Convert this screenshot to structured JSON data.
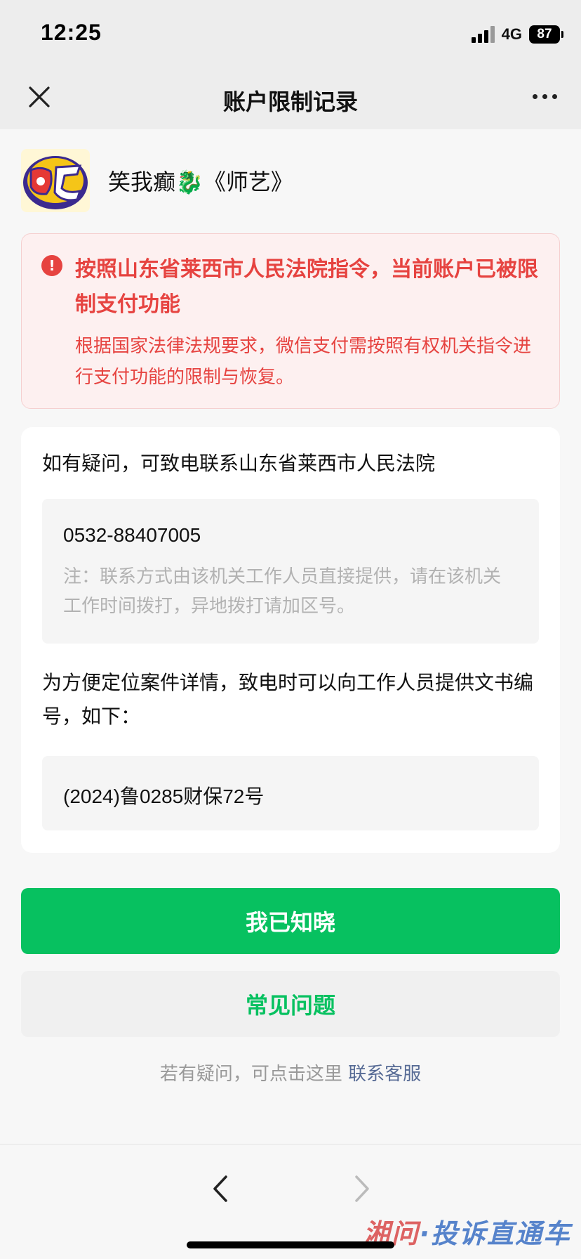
{
  "status_bar": {
    "time": "12:25",
    "network": "4G",
    "battery": "87"
  },
  "nav": {
    "title": "账户限制记录",
    "close_icon": "close-icon",
    "more_icon": "more-icon"
  },
  "account": {
    "name": "笑我癫🐉《师艺》",
    "avatar_icon": "avatar-image"
  },
  "notice": {
    "icon": "alert-icon",
    "color": "#e64340",
    "title": "按照山东省莱西市人民法院指令，当前账户已被限制支付功能",
    "description": "根据国家法律法规要求，微信支付需按照有权机关指令进行支付功能的限制与恢复。"
  },
  "contact": {
    "text": "如有疑问，可致电联系山东省莱西市人民法院",
    "phone": "0532-88407005",
    "note": "注：联系方式由该机关工作人员直接提供，请在该机关工作时间拨打，异地拨打请加区号。"
  },
  "case": {
    "text": "为方便定位案件详情，致电时可以向工作人员提供文书编号，如下：",
    "number": "(2024)鲁0285财保72号"
  },
  "buttons": {
    "primary_label": "我已知晓",
    "primary_color": "#07c160",
    "secondary_label": "常见问题"
  },
  "help": {
    "text": "若有疑问，可点击这里",
    "link": "联系客服",
    "link_color": "#576b95"
  },
  "toolbar": {
    "back_icon": "chevron-left-icon",
    "forward_icon": "chevron-right-icon"
  },
  "watermark": {
    "part1": "湘问",
    "part2": "·投诉直通车"
  }
}
